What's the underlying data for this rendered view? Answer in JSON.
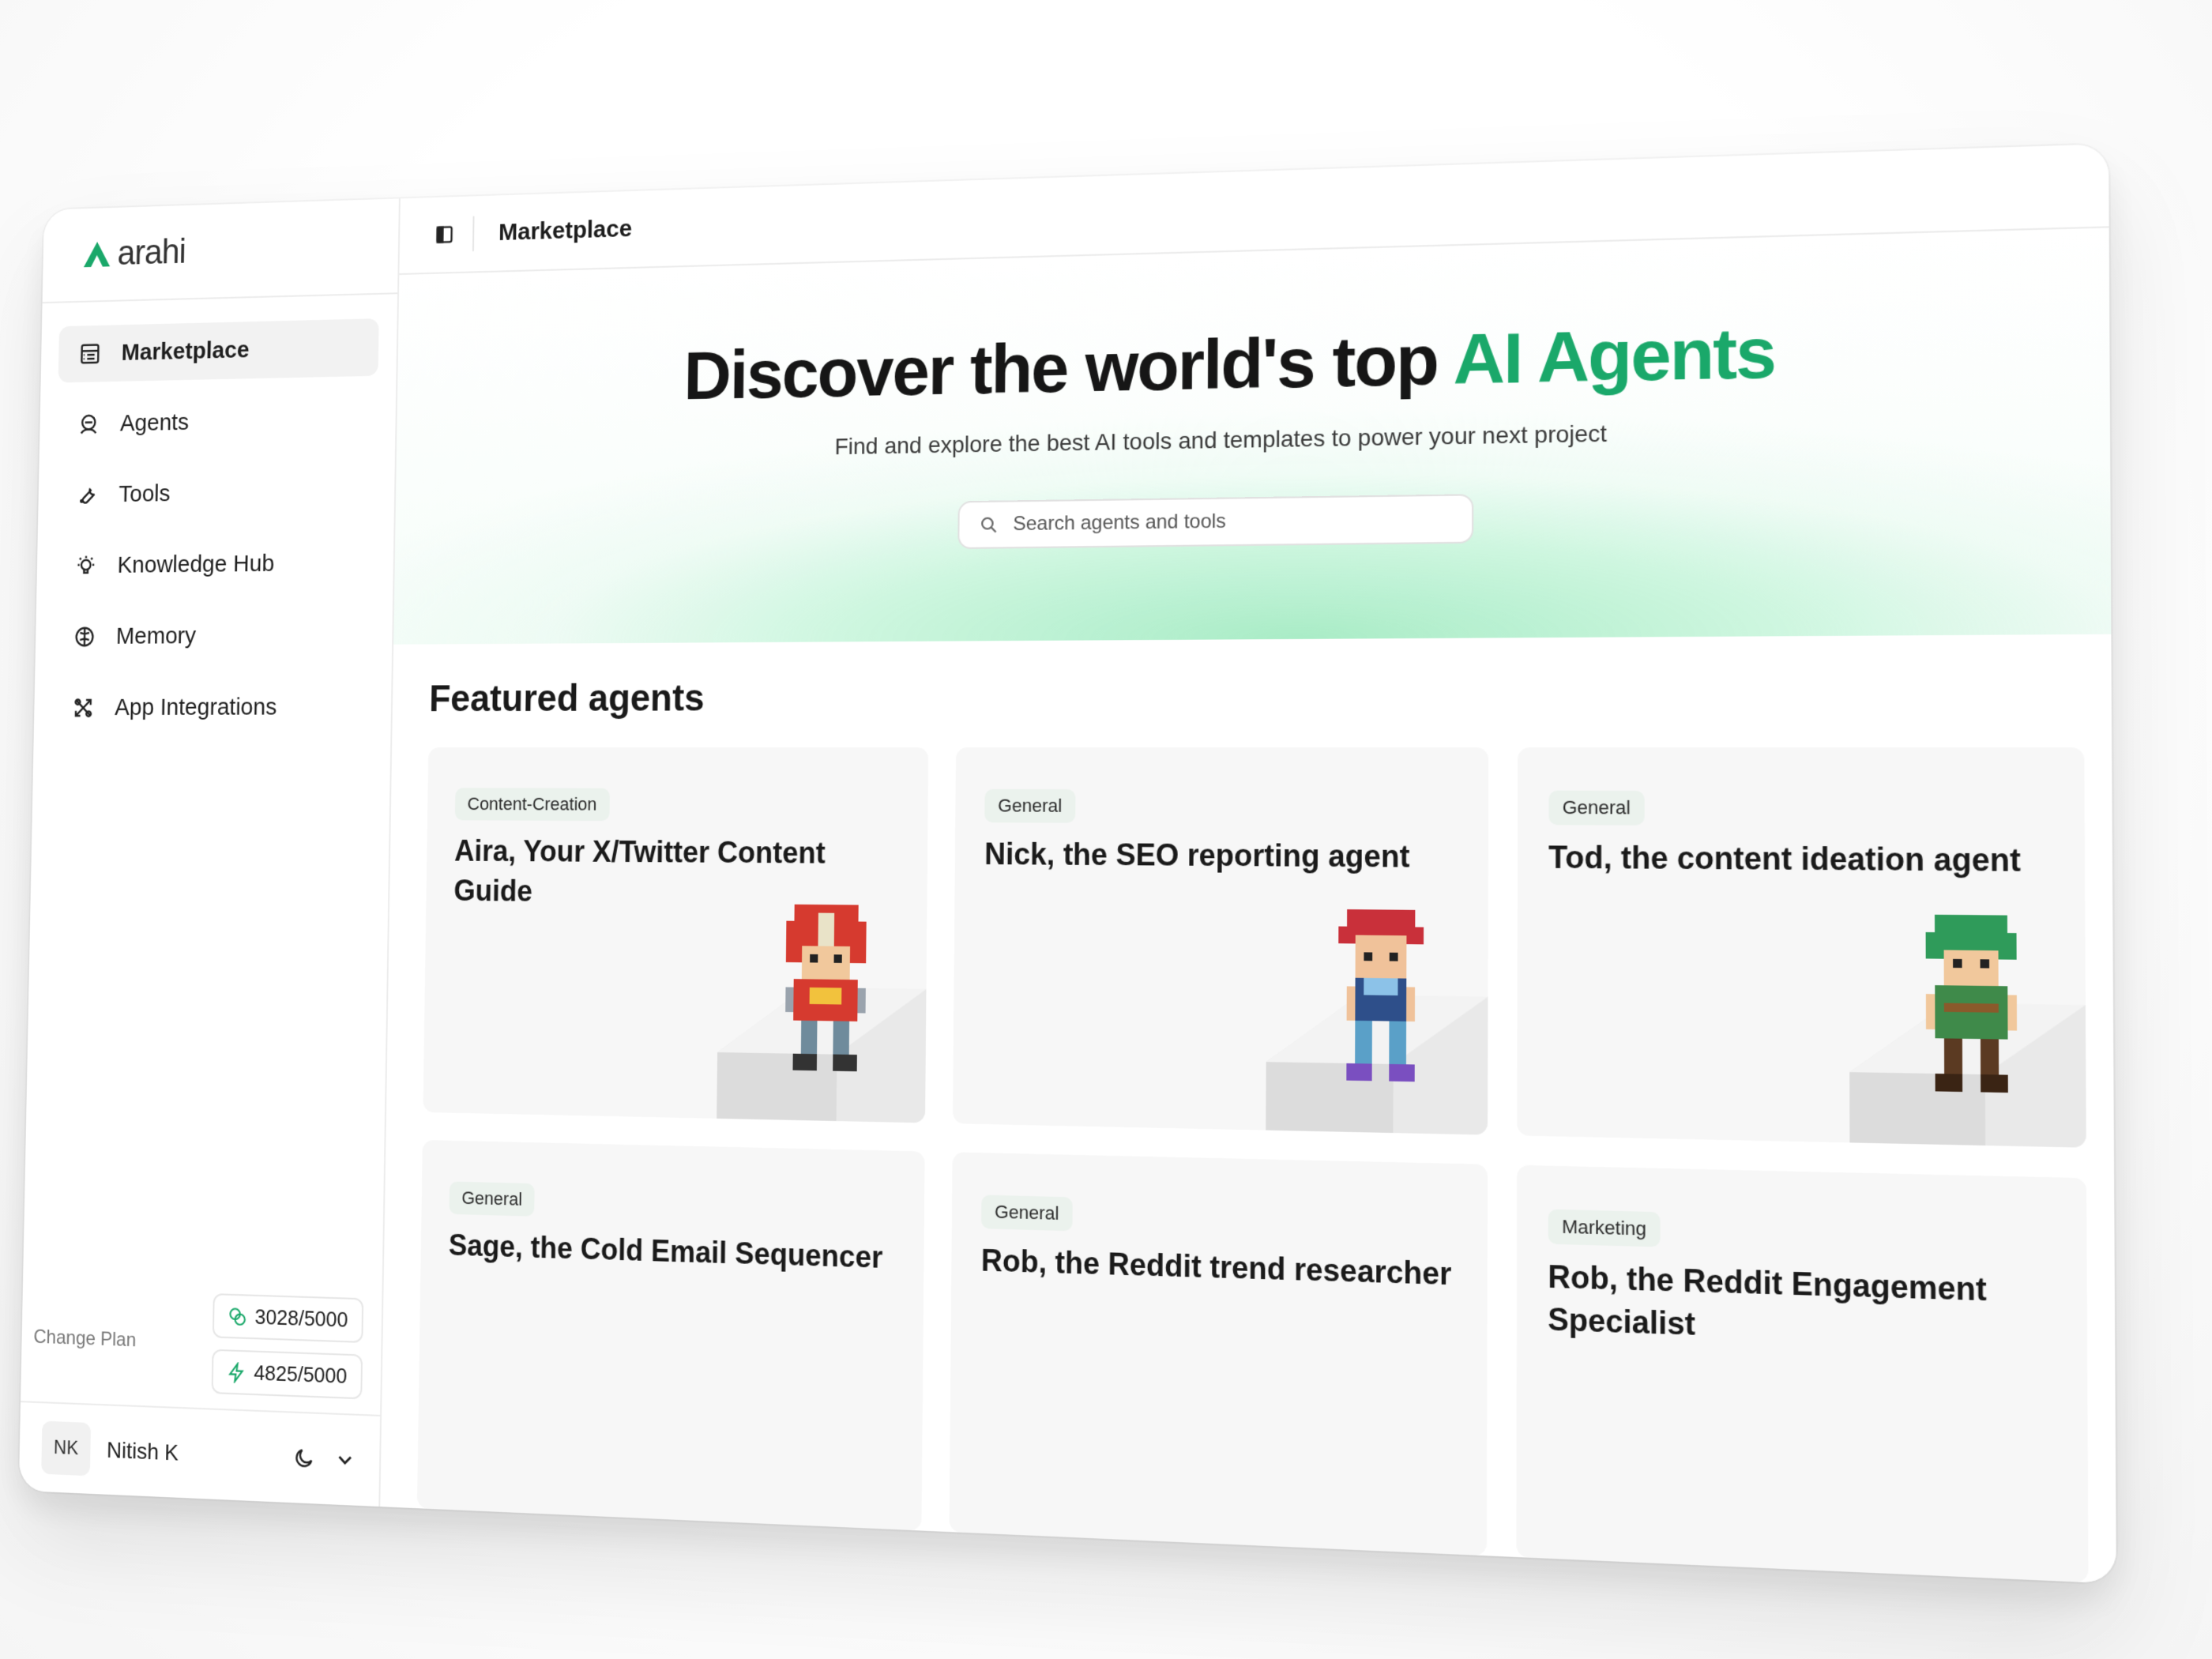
{
  "brand": {
    "name": "arahi",
    "accent": "#1aa86a"
  },
  "sidebar": {
    "items": [
      {
        "label": "Marketplace",
        "icon": "marketplace-icon",
        "active": true
      },
      {
        "label": "Agents",
        "icon": "agent-icon"
      },
      {
        "label": "Tools",
        "icon": "wrench-icon"
      },
      {
        "label": "Knowledge Hub",
        "icon": "lightbulb-icon"
      },
      {
        "label": "Memory",
        "icon": "brain-icon"
      },
      {
        "label": "App Integrations",
        "icon": "integrations-icon"
      }
    ],
    "change_plan": "Change Plan",
    "credits": "3028/5000",
    "energy": "4825/5000",
    "user": {
      "initials": "NK",
      "name": "Nitish K"
    }
  },
  "topbar": {
    "title": "Marketplace"
  },
  "hero": {
    "title_main": "Discover the world's top",
    "title_accent": "AI Agents",
    "subtitle": "Find and explore the best AI tools and templates to power your next project",
    "search_placeholder": "Search agents and tools"
  },
  "featured": {
    "heading": "Featured agents",
    "cards": [
      {
        "tag": "Content-Creation",
        "title": "Aira, Your X/Twitter Content Guide",
        "sprite": "red-armor-hero"
      },
      {
        "tag": "General",
        "title": "Nick, the SEO reporting agent",
        "sprite": "red-haired-boy"
      },
      {
        "tag": "General",
        "title": "Tod, the content ideation agent",
        "sprite": "green-haired-ranger"
      },
      {
        "tag": "General",
        "title": "Sage, the Cold Email Sequencer",
        "sprite": "blue-hood"
      },
      {
        "tag": "General",
        "title": "Rob, the Reddit trend researcher",
        "sprite": "brown-hair"
      },
      {
        "tag": "Marketing",
        "title": "Rob, the Reddit Engagement Specialist",
        "sprite": "none"
      }
    ]
  }
}
